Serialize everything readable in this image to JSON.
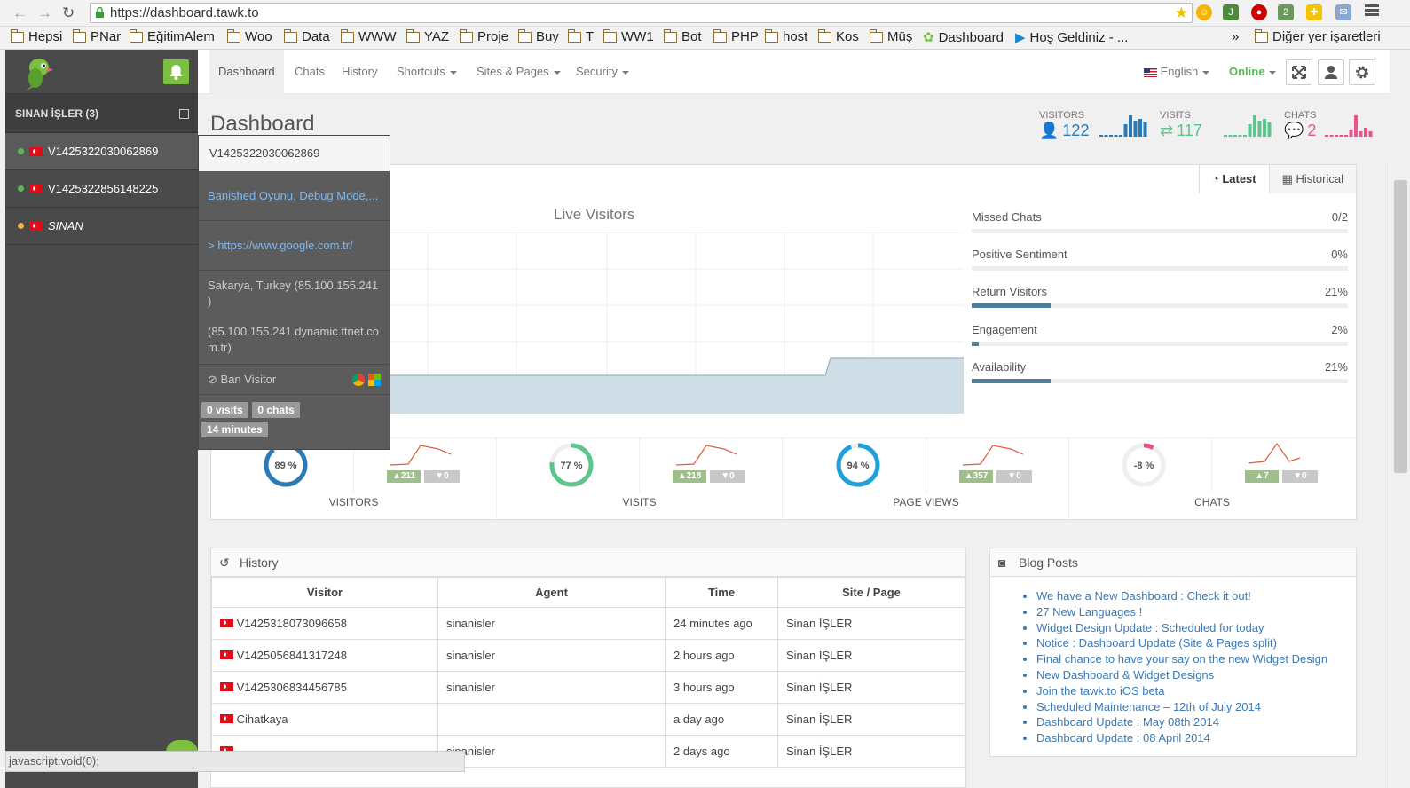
{
  "browser": {
    "url": "https://dashboard.tawk.to",
    "bookmarks": [
      "Hepsi",
      "PNar",
      "EğitimAlem",
      "Woo",
      "Data",
      "WWW",
      "YAZ",
      "Proje",
      "Buy",
      "T",
      "WW1",
      "Bot",
      "PHP",
      "host",
      "Kos",
      "Müş",
      "Dashboard",
      "Hoş Geldiniz - ..."
    ],
    "more": "»",
    "other_bookmarks": "Diğer yer işaretleri",
    "status_bar": "javascript:void(0);"
  },
  "sidebar": {
    "group_label": "SINAN İŞLER (3)",
    "visitors": [
      {
        "name": "V1425322030062869",
        "status_color": "#5cb85c"
      },
      {
        "name": "V1425322856148225",
        "status_color": "#5cb85c"
      },
      {
        "name": "SINAN",
        "status_color": "#f0ad4e"
      }
    ]
  },
  "popup": {
    "title": "V1425322030062869",
    "page": "Banished Oyunu, Debug Mode,...",
    "referrer": "> https://www.google.com.tr/",
    "location": "Sakarya, Turkey (85.100.155.241 )",
    "host": "(85.100.155.241.dynamic.ttnet.com.tr)",
    "ban": "Ban Visitor",
    "badges": [
      "0 visits",
      "0 chats",
      "14 minutes"
    ]
  },
  "nav": {
    "items": [
      "Dashboard",
      "Chats",
      "History",
      "Shortcuts",
      "Sites & Pages",
      "Security"
    ],
    "language": "English",
    "status": "Online"
  },
  "main": {
    "title": "Dashboard",
    "stats": [
      {
        "label": "VISITORS",
        "value": "122",
        "color": "#2a7ab8"
      },
      {
        "label": "VISITS",
        "value": "117",
        "color": "#5cc48c"
      },
      {
        "label": "CHATS",
        "value": "2",
        "color": "#e8558d"
      }
    ],
    "tabs": [
      "Latest",
      "Historical"
    ],
    "live_title": "Live Visitors",
    "metrics": [
      {
        "label": "Missed Chats",
        "value": "0/2",
        "fill": 0
      },
      {
        "label": "Positive Sentiment",
        "value": "0%",
        "fill": 0
      },
      {
        "label": "Return Visitors",
        "value": "21%",
        "fill": 0.21
      },
      {
        "label": "Engagement",
        "value": "2%",
        "fill": 0.02
      },
      {
        "label": "Availability",
        "value": "21%",
        "fill": 0.21
      }
    ],
    "kpis": [
      {
        "label": "VISITORS",
        "pct": "89 %",
        "fraction": 0.89,
        "color": "#2a7ab8",
        "up": "▲211",
        "down": "▼0"
      },
      {
        "label": "VISITS",
        "pct": "77 %",
        "fraction": 0.77,
        "color": "#5cc48c",
        "up": "▲218",
        "down": "▼0"
      },
      {
        "label": "PAGE VIEWS",
        "pct": "94 %",
        "fraction": 0.94,
        "color": "#1ea0d8",
        "up": "▲357",
        "down": "▼0"
      },
      {
        "label": "CHATS",
        "pct": "-8 %",
        "fraction": 0.08,
        "color": "#e8558d",
        "up": "▲7",
        "down": "▼0"
      }
    ]
  },
  "history": {
    "title": "History",
    "columns": [
      "Visitor",
      "Agent",
      "Time",
      "Site / Page"
    ],
    "rows": [
      [
        "V1425318073096658",
        "sinanisler",
        "24 minutes ago",
        "Sinan İŞLER"
      ],
      [
        "V1425056841317248",
        "sinanisler",
        "2 hours ago",
        "Sinan İŞLER"
      ],
      [
        "V1425306834456785",
        "sinanisler",
        "3 hours ago",
        "Sinan İŞLER"
      ],
      [
        "Cihatkaya",
        "",
        "a day ago",
        "Sinan İŞLER"
      ],
      [
        "",
        "sinanisler",
        "2 days ago",
        "Sinan İŞLER"
      ]
    ]
  },
  "blog": {
    "title": "Blog Posts",
    "posts": [
      "We have a New Dashboard : Check it out!",
      "27 New Languages !",
      "Widget Design Update : Scheduled for today",
      "Notice : Dashboard Update (Site & Pages split)",
      "Final chance to have your say on the new Widget Design",
      "New Dashboard & Widget Designs",
      "Join the tawk.to iOS beta",
      "Scheduled Maintenance – 12th of July 2014",
      "Dashboard Update : May 08th 2014",
      "Dashboard Update : 08 April 2014"
    ]
  }
}
